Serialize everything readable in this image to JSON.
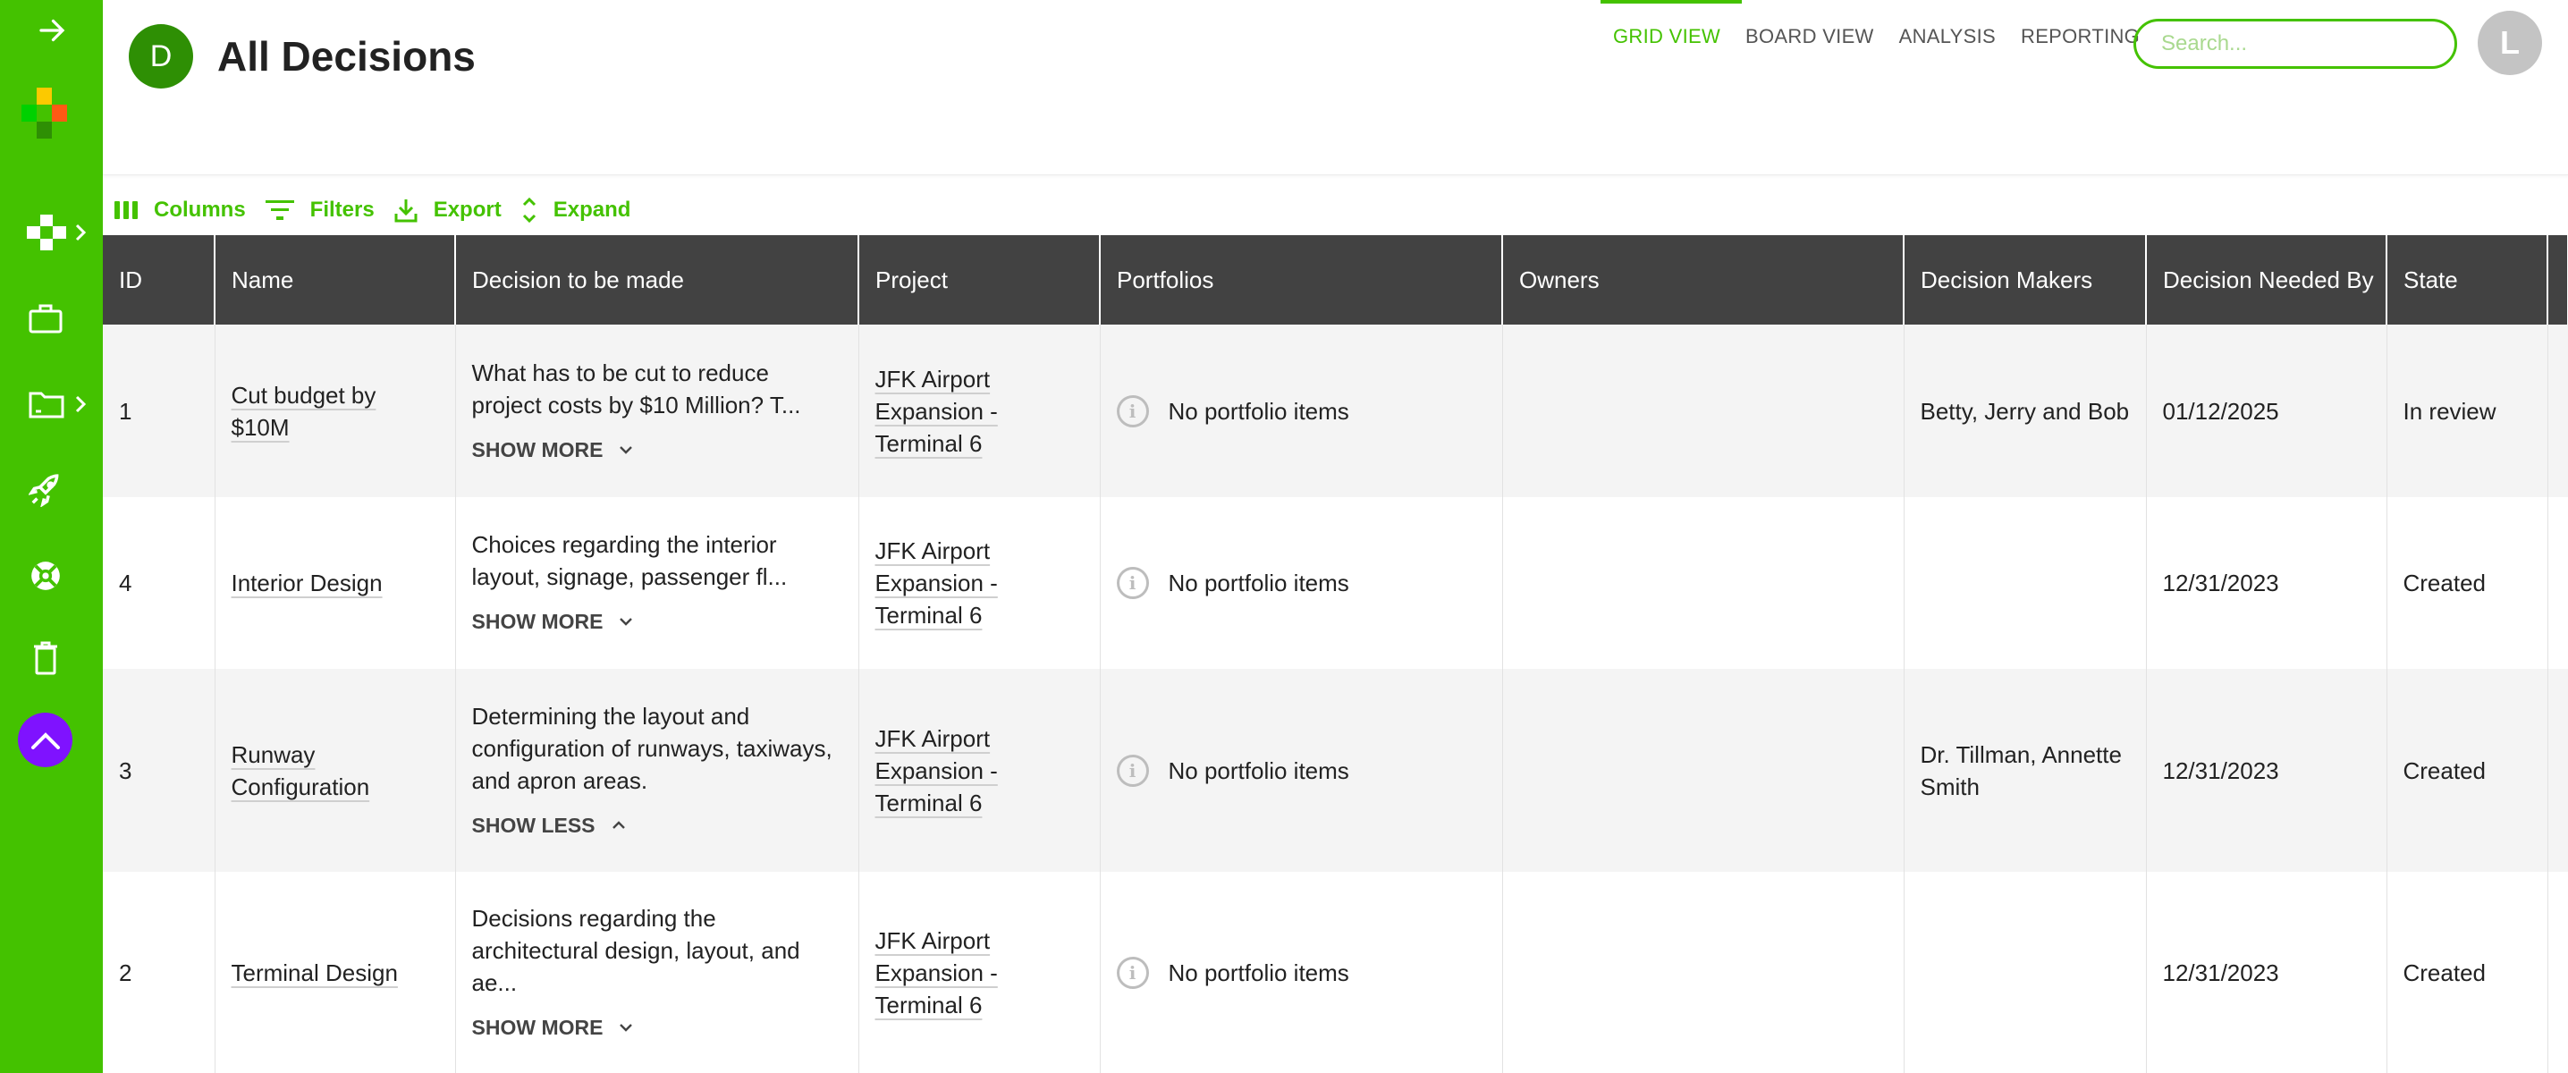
{
  "brand": {
    "accent": "#44c200",
    "logo_colors": [
      "#fcc900",
      "#00d100",
      "#44c200",
      "#ff5a14",
      "#2e8f04"
    ]
  },
  "sidebar": {
    "items": [
      {
        "icon": "arrow-right-icon",
        "label": "Expand sidebar"
      },
      {
        "icon": "grid-cross-icon",
        "label": "Dashboards",
        "has_submenu": true
      },
      {
        "icon": "briefcase-icon",
        "label": "Work"
      },
      {
        "icon": "folder-icon",
        "label": "Folders",
        "has_submenu": true
      },
      {
        "icon": "rocket-icon",
        "label": "Launch"
      },
      {
        "icon": "lifebuoy-icon",
        "label": "Help"
      },
      {
        "icon": "trash-icon",
        "label": "Trash"
      }
    ],
    "scroll_top_icon": "chevron-up-icon"
  },
  "header": {
    "avatar_letter": "D",
    "title": "All Decisions",
    "nav": [
      {
        "label": "GRID VIEW",
        "active": true
      },
      {
        "label": "BOARD VIEW",
        "active": false
      },
      {
        "label": "ANALYSIS",
        "active": false
      },
      {
        "label": "REPORTING",
        "active": false
      }
    ],
    "search": {
      "placeholder": "Search...",
      "value": ""
    },
    "user_initial": "L"
  },
  "toolbar": {
    "columns_label": "Columns",
    "filters_label": "Filters",
    "export_label": "Export",
    "expand_label": "Expand"
  },
  "table": {
    "columns": [
      "ID",
      "Name",
      "Decision to be made",
      "Project",
      "Portfolios",
      "Owners",
      "Decision Makers",
      "Decision Needed By",
      "State",
      ""
    ],
    "rows": [
      {
        "id": "1",
        "name": "Cut budget by $10M",
        "decision": "What has to be cut to reduce project costs by $10 Million? T...",
        "toggle": "SHOW MORE",
        "expanded": false,
        "project": "JFK Airport Expansion - Terminal 6",
        "portfolios": "No portfolio items",
        "owners": "",
        "decision_makers": "Betty, Jerry and Bob",
        "needed_by": "01/12/2025",
        "state": "In review"
      },
      {
        "id": "4",
        "name": "Interior Design",
        "decision": "Choices regarding the interior layout, signage, passenger fl...",
        "toggle": "SHOW MORE",
        "expanded": false,
        "project": "JFK Airport Expansion - Terminal 6",
        "portfolios": "No portfolio items",
        "owners": "",
        "decision_makers": "",
        "needed_by": "12/31/2023",
        "state": "Created"
      },
      {
        "id": "3",
        "name": "Runway Configuration",
        "decision": "Determining the layout and configuration of runways, taxiways, and apron areas.",
        "toggle": "SHOW LESS",
        "expanded": true,
        "project": "JFK Airport Expansion - Terminal 6",
        "portfolios": "No portfolio items",
        "owners": "",
        "decision_makers": "Dr. Tillman, Annette Smith",
        "needed_by": "12/31/2023",
        "state": "Created"
      },
      {
        "id": "2",
        "name": "Terminal Design",
        "decision": "Decisions regarding the architectural design, layout, and ae...",
        "toggle": "SHOW MORE",
        "expanded": false,
        "project": "JFK Airport Expansion - Terminal 6",
        "portfolios": "No portfolio items",
        "owners": "",
        "decision_makers": "",
        "needed_by": "12/31/2023",
        "state": "Created"
      }
    ]
  }
}
